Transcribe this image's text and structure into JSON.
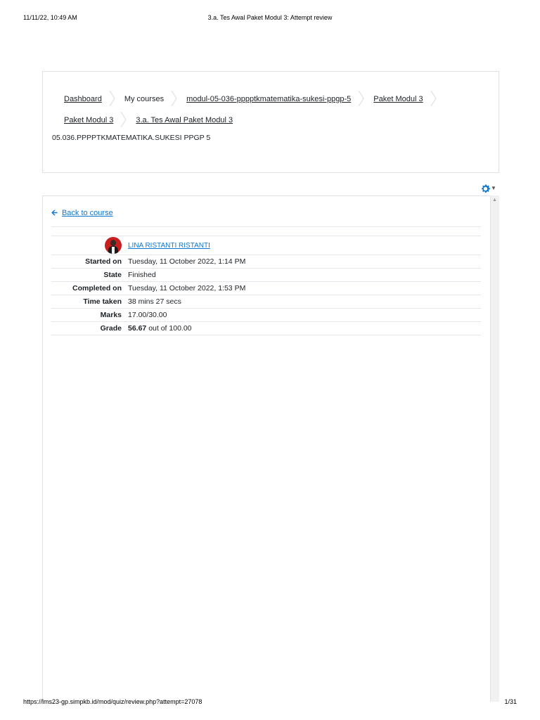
{
  "print_header": {
    "datetime": "11/11/22, 10:49 AM",
    "title": "3.a. Tes Awal Paket Modul 3: Attempt review"
  },
  "print_footer": {
    "url": "https://lms23-gp.simpkb.id/mod/quiz/review.php?attempt=27078",
    "page": "1/31"
  },
  "breadcrumb": [
    {
      "label": "Dashboard",
      "link": true
    },
    {
      "label": "My courses",
      "link": false
    },
    {
      "label": "modul-05-036-pppptkmatematika-sukesi-ppgp-5",
      "link": true
    },
    {
      "label": "Paket Modul 3",
      "link": true
    },
    {
      "label": "Paket Modul 3",
      "link": true
    },
    {
      "label": "3.a. Tes Awal Paket Modul 3",
      "link": true
    }
  ],
  "course_code": "05.036.PPPPTKMATEMATIKA.SUKESI PPGP 5",
  "icons": {
    "settings": "gear-icon",
    "back": "arrow-left-icon"
  },
  "colors": {
    "link": "#1177d1",
    "border": "#dee2e6"
  },
  "back_link": "Back to course",
  "summary": {
    "user_name": "LINA RISTANTI RISTANTI",
    "rows": [
      {
        "label": "Started on",
        "value": "Tuesday, 11 October 2022, 1:14 PM"
      },
      {
        "label": "State",
        "value": "Finished"
      },
      {
        "label": "Completed on",
        "value": "Tuesday, 11 October 2022, 1:53 PM"
      },
      {
        "label": "Time taken",
        "value": "38 mins 27 secs"
      },
      {
        "label": "Marks",
        "value": "17.00/30.00"
      }
    ],
    "grade_label": "Grade",
    "grade_value": "56.67",
    "grade_suffix": " out of 100.00"
  }
}
